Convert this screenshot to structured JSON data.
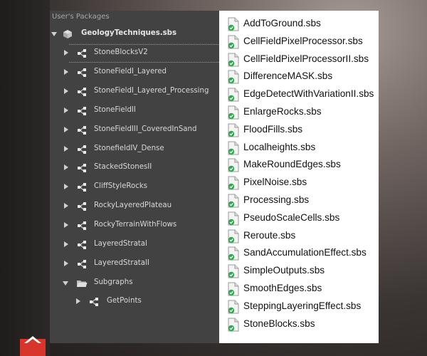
{
  "tree_panel": {
    "title": "User's Packages",
    "root": {
      "label": "GeologyTechniques.sbs",
      "icon": "package-cube-icon",
      "expanded": true
    },
    "items": [
      {
        "label": "StoneBlocksV2",
        "icon": "graph-node-icon"
      },
      {
        "label": "StoneFieldI_Layered",
        "icon": "graph-node-icon"
      },
      {
        "label": "StoneFieldI_Layered_Processing",
        "icon": "graph-node-icon"
      },
      {
        "label": "StoneFieldII",
        "icon": "graph-node-icon"
      },
      {
        "label": "StoneFieldIII_CoveredInSand",
        "icon": "graph-node-icon"
      },
      {
        "label": "StonefieldIV_Dense",
        "icon": "graph-node-icon"
      },
      {
        "label": "StackedStonesII",
        "icon": "graph-node-icon"
      },
      {
        "label": "CliffStyleRocks",
        "icon": "graph-node-icon"
      },
      {
        "label": "RockyLayeredPlateau",
        "icon": "graph-node-icon"
      },
      {
        "label": "RockyTerrainWithFlows",
        "icon": "graph-node-icon"
      },
      {
        "label": "LayeredStratal",
        "icon": "graph-node-icon"
      },
      {
        "label": "LayeredStratalI",
        "icon": "graph-node-icon"
      }
    ],
    "folder": {
      "label": "Subgraphs",
      "icon": "folder-open-icon",
      "expanded": true
    },
    "child": {
      "label": "GetPoints",
      "icon": "graph-node-icon"
    }
  },
  "file_list": {
    "icon": "sbs-file-check-icon",
    "files": [
      "AddToGround.sbs",
      "CellFieldPixelProcessor.sbs",
      "CellFieldPixelProcessorII.sbs",
      "DifferenceMASK.sbs",
      "EdgeDetectWithVariationII.sbs",
      "EnlargeRocks.sbs",
      "FloodFills.sbs",
      "Localheights.sbs",
      "MakeRoundEdges.sbs",
      "PixelNoise.sbs",
      "Processing.sbs",
      "PseudoScaleCells.sbs",
      "Reroute.sbs",
      "SandAccumulationEffect.sbs",
      "SimpleOutputs.sbs",
      "SmoothEdges.sbs",
      "SteppingLayeringEffect.sbs",
      "StoneBlocks.sbs"
    ]
  },
  "colors": {
    "tree_bg": "#424242",
    "file_bg": "#ffffff",
    "check_green": "#2fa84f",
    "badge_red": "#d9362b"
  }
}
